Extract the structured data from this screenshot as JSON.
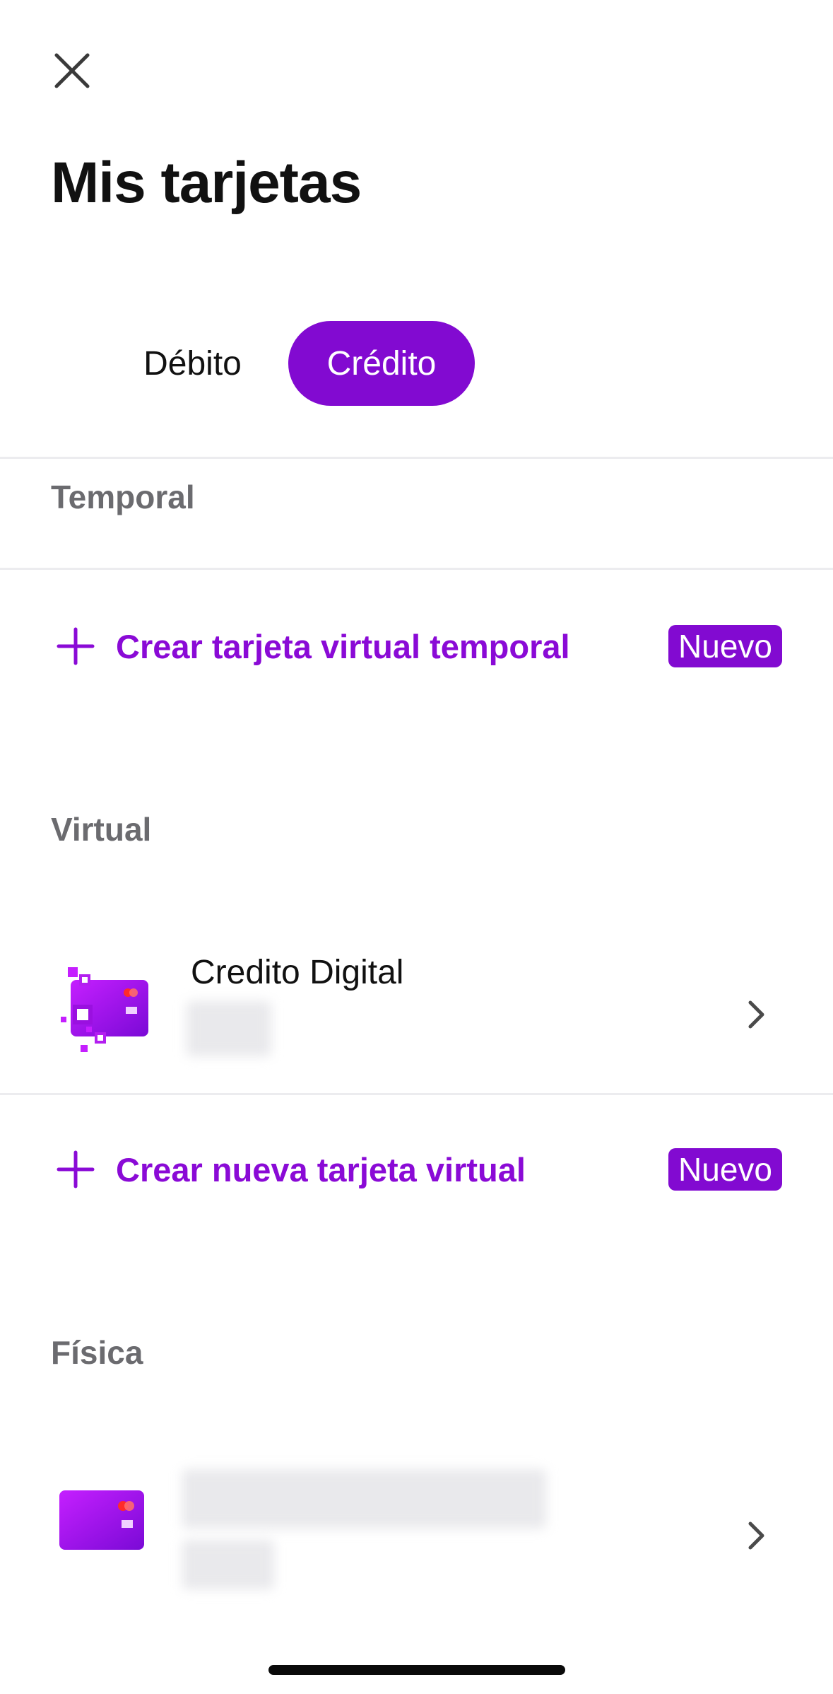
{
  "header": {
    "close_icon": "close-icon",
    "title": "Mis tarjetas"
  },
  "tabs": [
    {
      "label": "Débito",
      "selected": false
    },
    {
      "label": "Crédito",
      "selected": true
    }
  ],
  "sections": {
    "temporal": {
      "label": "Temporal",
      "action": {
        "label": "Crear tarjeta virtual temporal",
        "badge": "Nuevo",
        "icon": "plus-icon"
      }
    },
    "virtual": {
      "label": "Virtual",
      "card": {
        "name": "Credito Digital",
        "icon": "virtual-card-icon",
        "detail_hidden": true
      },
      "action": {
        "label": "Crear nueva tarjeta virtual",
        "badge": "Nuevo",
        "icon": "plus-icon"
      }
    },
    "fisica": {
      "label": "Física",
      "card": {
        "icon": "physical-card-icon",
        "detail_hidden": true
      }
    }
  },
  "colors": {
    "brand": "#820ad1",
    "brand_text": "#8a0ad6",
    "section_label": "#6b6b6f",
    "divider": "#ececef"
  }
}
